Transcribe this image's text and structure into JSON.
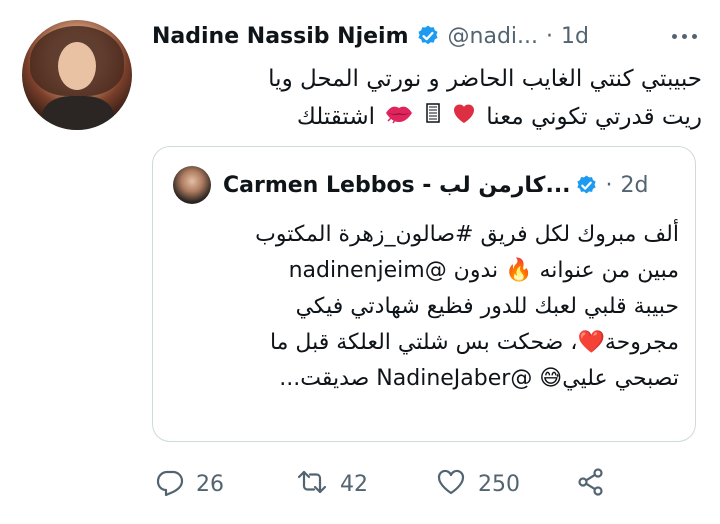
{
  "tweet": {
    "author_name": "Nadine Nassib Njeim",
    "handle": "@nadi...",
    "separator": "·",
    "time": "1d",
    "line1": "حبيبتي كنتي الغايب الحاضر و نورتي المحل ويا",
    "line2_text": "ريت قدرتي تكوني معنا",
    "line2_end": "اشتقتلك",
    "more_icon": "more-icon",
    "avatar_icon": "avatar"
  },
  "quote": {
    "author_name": "Carmen Lebbos - كارمن لب...",
    "separator": "·",
    "time": "2d",
    "lines": [
      "ألف مبروك لكل فريق #صالون_زهرة المكتوب",
      "مبين من عنوانه 🔥 ندون @nadinenjeim",
      "حبيبة قلبي لعبك للدور فظيع شهادتي فيكي",
      "مجروحة❤️، ضحكت بس شلتي العلكة قبل ما",
      "تصبحي عليي😅 @NadineJaber صديقت..."
    ]
  },
  "actions": {
    "replies": "26",
    "retweets": "42",
    "likes": "250"
  },
  "colors": {
    "text": "#0f1419",
    "secondary": "#536471",
    "verified": "#1d9bf0",
    "border": "#cfd9de"
  }
}
